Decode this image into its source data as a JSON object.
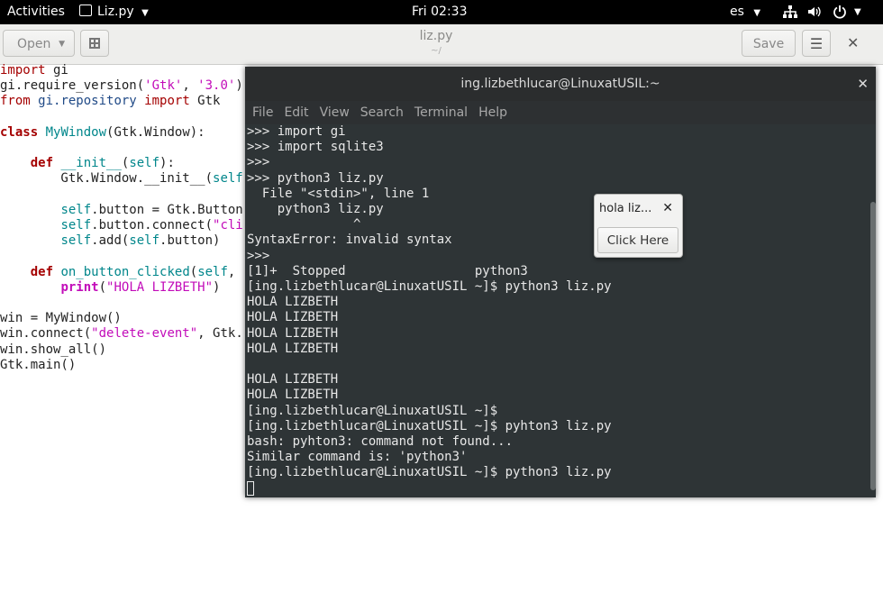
{
  "topbar": {
    "activities": "Activities",
    "app_menu": "Liz.py",
    "clock": "Fri 02:33",
    "language": "es"
  },
  "editor": {
    "open_label": "Open",
    "title": "liz.py",
    "subtitle": "~/",
    "save_label": "Save",
    "code_lines": [
      "import gi",
      "gi.require_version('Gtk', '3.0')",
      "from gi.repository import Gtk",
      "",
      "class MyWindow(Gtk.Window):",
      "",
      "    def __init__(self):",
      "        Gtk.Window.__init__(self",
      "",
      "        self.button = Gtk.Button",
      "        self.button.connect(\"cli",
      "        self.add(self.button)",
      "",
      "    def on_button_clicked(self,",
      "        print(\"HOLA LIZBETH\")",
      "",
      "win = MyWindow()",
      "win.connect(\"delete-event\", Gtk.",
      "win.show_all()",
      "Gtk.main()"
    ]
  },
  "terminal": {
    "title": "ing.lizbethlucar@LinuxatUSIL:~",
    "menu": [
      "File",
      "Edit",
      "View",
      "Search",
      "Terminal",
      "Help"
    ],
    "lines": [
      ">>> import gi",
      ">>> import sqlite3",
      ">>>",
      ">>> python3 liz.py",
      "  File \"<stdin>\", line 1",
      "    python3 liz.py",
      "              ^",
      "SyntaxError: invalid syntax",
      ">>>",
      "[1]+  Stopped                 python3",
      "[ing.lizbethlucar@LinuxatUSIL ~]$ python3 liz.py",
      "HOLA LIZBETH",
      "HOLA LIZBETH",
      "HOLA LIZBETH",
      "HOLA LIZBETH",
      "",
      "HOLA LIZBETH",
      "HOLA LIZBETH",
      "[ing.lizbethlucar@LinuxatUSIL ~]$",
      "[ing.lizbethlucar@LinuxatUSIL ~]$ pyhton3 liz.py",
      "bash: pyhton3: command not found...",
      "Similar command is: 'python3'",
      "[ing.lizbethlucar@LinuxatUSIL ~]$ python3 liz.py"
    ]
  },
  "popup": {
    "title": "hola liz...",
    "button_label": "Click Here"
  }
}
